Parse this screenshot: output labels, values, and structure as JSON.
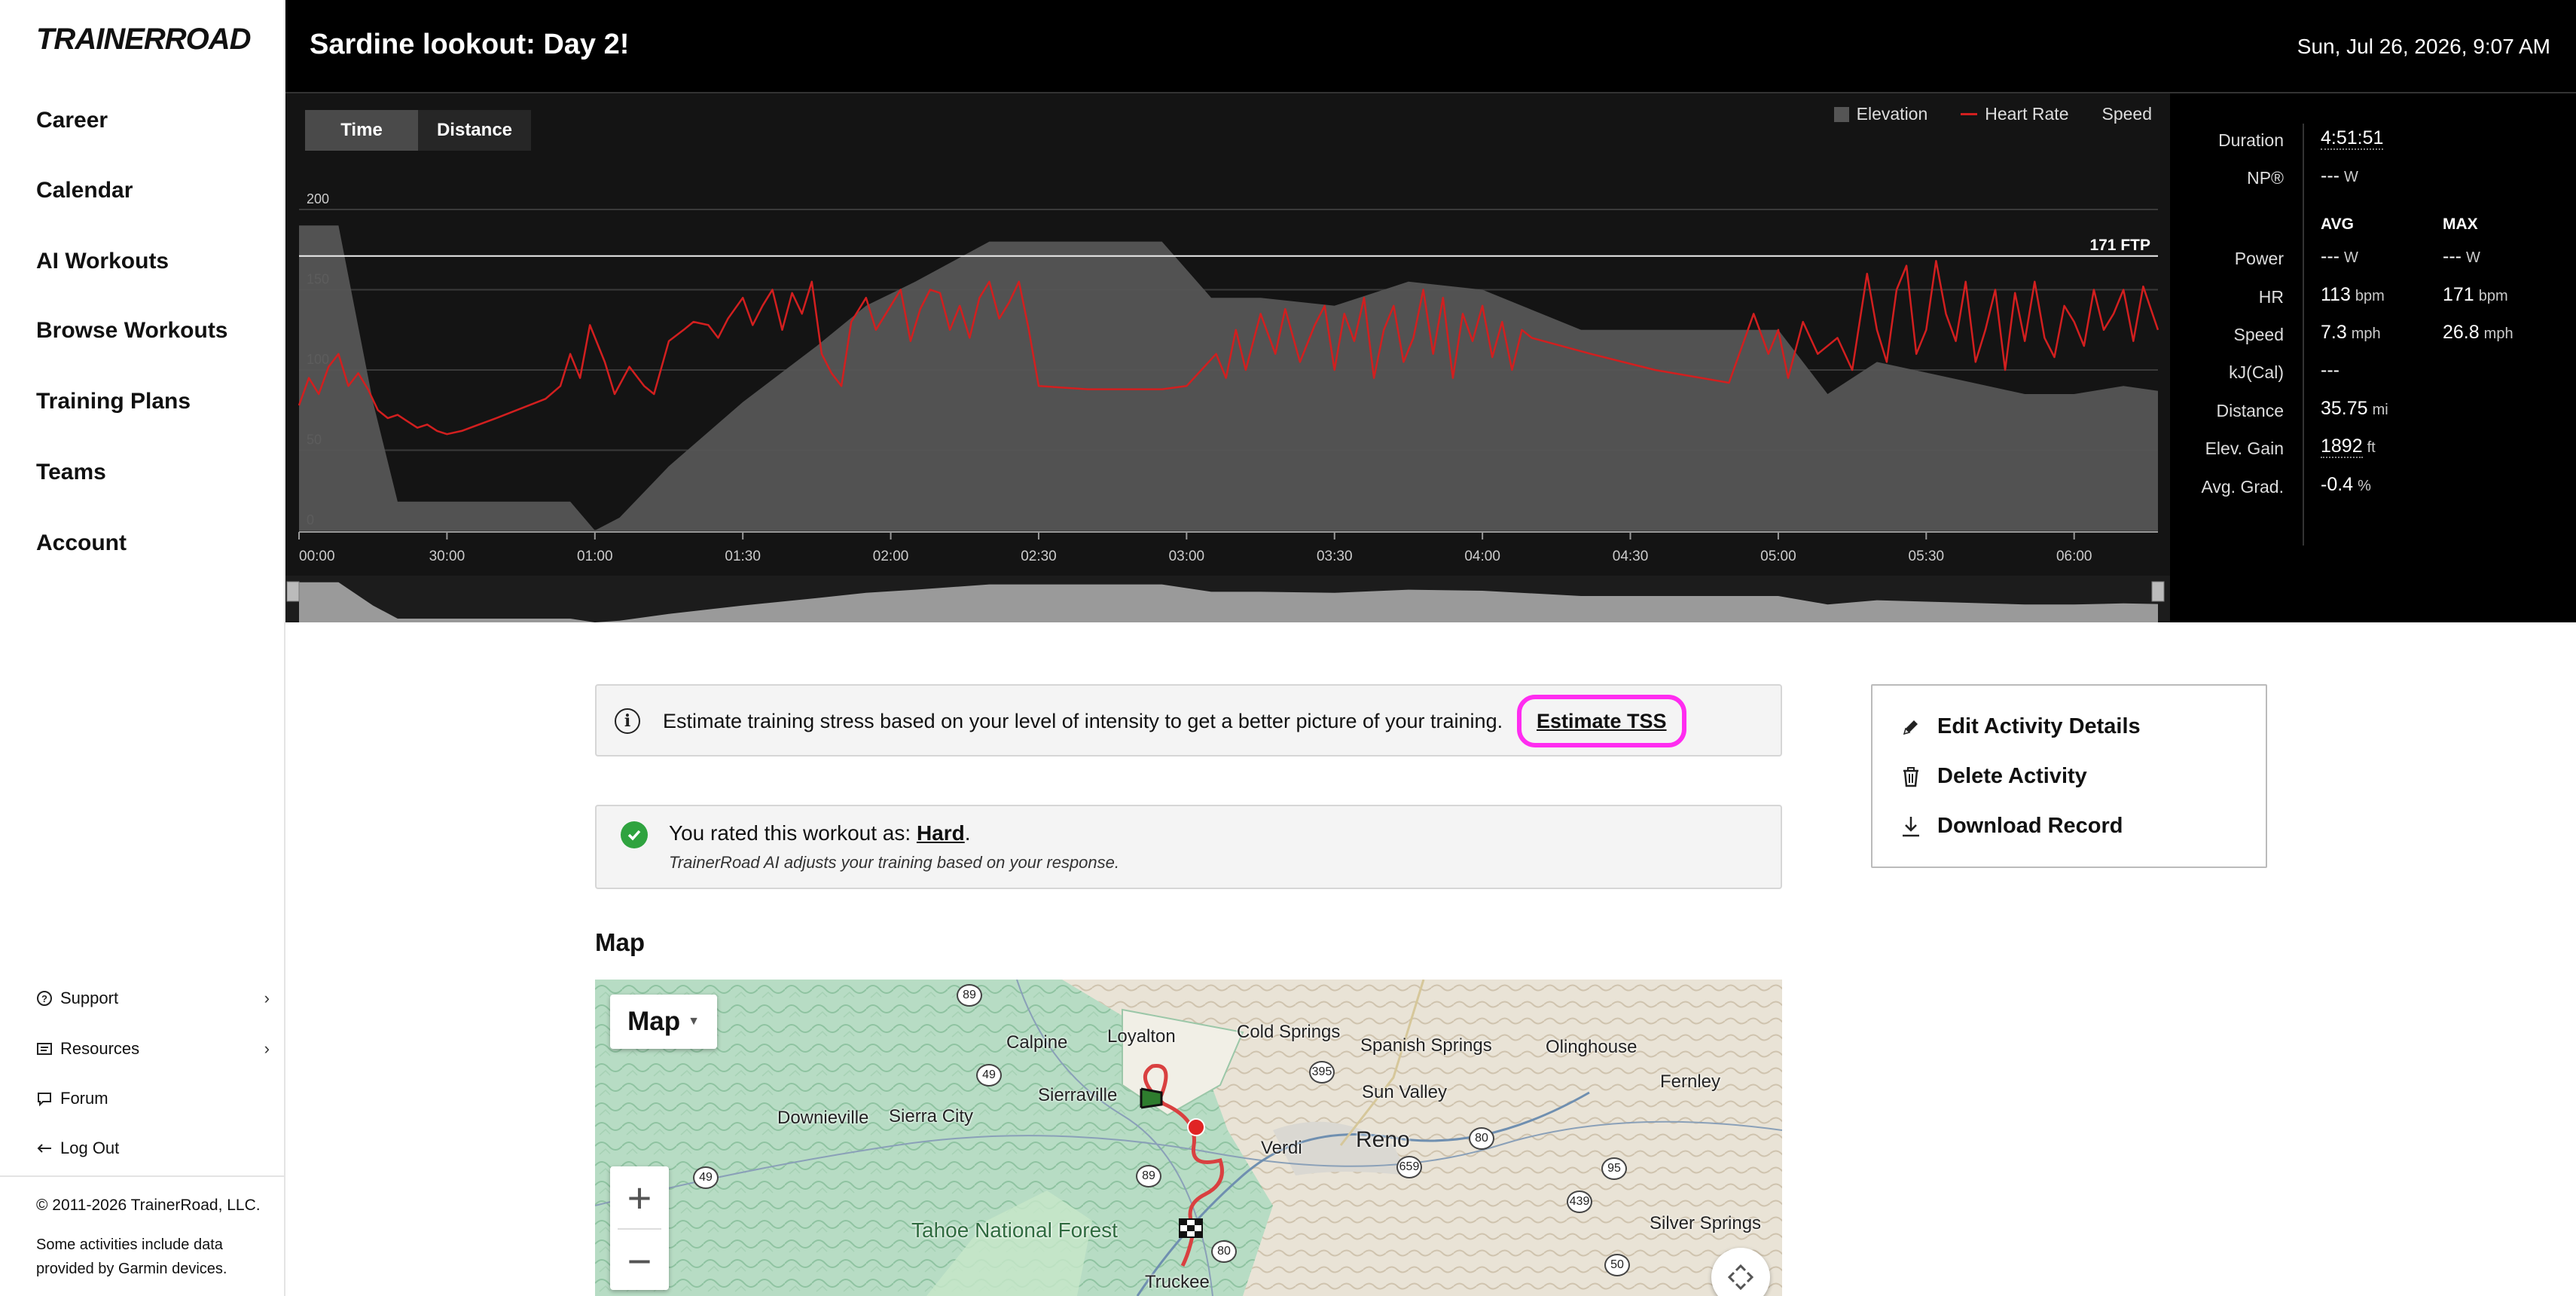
{
  "sidebar": {
    "logo": "TRAINERROAD",
    "nav": [
      "Career",
      "Calendar",
      "AI Workouts",
      "Browse Workouts",
      "Training Plans",
      "Teams",
      "Account"
    ],
    "utility": [
      {
        "label": "Support",
        "icon": "question-circle-icon",
        "has_chevron": true
      },
      {
        "label": "Resources",
        "icon": "book-icon",
        "has_chevron": true
      },
      {
        "label": "Forum",
        "icon": "chat-icon",
        "has_chevron": false
      },
      {
        "label": "Log Out",
        "icon": "arrow-left-icon",
        "has_chevron": false
      }
    ],
    "copyright": "© 2011-2026 TrainerRoad, LLC.",
    "garmin_note": "Some activities include data provided by Garmin devices."
  },
  "header": {
    "title": "Sardine lookout: Day 2!",
    "date": "Sun, Jul 26, 2026, 9:07 AM"
  },
  "chart": {
    "tabs": [
      {
        "label": "Time",
        "active": true
      },
      {
        "label": "Distance",
        "active": false
      }
    ],
    "legend": [
      {
        "label": "Elevation",
        "kind": "swatch",
        "color": "#555555"
      },
      {
        "label": "Heart Rate",
        "kind": "line",
        "color": "#d21f1f"
      },
      {
        "label": "Speed",
        "kind": "none",
        "color": "#888888"
      }
    ],
    "ftp_label": "171 FTP"
  },
  "chart_data": {
    "type": "line",
    "xlabel": "",
    "ylabel": "",
    "y_ticks": [
      "0",
      "50",
      "100",
      "150",
      "200"
    ],
    "ylim": [
      0,
      200
    ],
    "x_ticks": [
      "00:00",
      "30:00",
      "01:00",
      "01:30",
      "02:00",
      "02:30",
      "03:00",
      "03:30",
      "04:00",
      "04:30",
      "05:00",
      "05:30",
      "06:00"
    ],
    "x_tick_minutes": [
      0,
      30,
      60,
      90,
      120,
      150,
      180,
      210,
      240,
      270,
      300,
      330,
      360
    ],
    "xlim_minutes": [
      0,
      377
    ],
    "ftp_line": {
      "label": "171 FTP",
      "value": 171
    },
    "series": [
      {
        "name": "Elevation",
        "kind": "area",
        "color": "#555555",
        "x_minutes": [
          0,
          8,
          15,
          20,
          55,
          60,
          65,
          75,
          90,
          105,
          115,
          125,
          140,
          150,
          175,
          185,
          195,
          210,
          225,
          240,
          260,
          280,
          300,
          310,
          320,
          335,
          350,
          360,
          370,
          377
        ],
        "values": [
          190,
          190,
          80,
          18,
          18,
          0,
          8,
          40,
          80,
          115,
          140,
          155,
          180,
          180,
          180,
          145,
          145,
          140,
          155,
          150,
          125,
          125,
          125,
          85,
          105,
          95,
          85,
          85,
          90,
          87
        ]
      },
      {
        "name": "Heart Rate",
        "kind": "line",
        "color": "#d21f1f",
        "x_minutes": [
          0,
          2,
          4,
          6,
          8,
          10,
          12,
          14,
          16,
          18,
          20,
          22,
          24,
          26,
          28,
          30,
          33,
          40,
          50,
          53,
          55,
          57,
          59,
          62,
          64,
          67,
          70,
          72,
          75,
          78,
          80,
          83,
          85,
          87,
          90,
          92,
          94,
          96,
          98,
          100,
          102,
          104,
          106,
          108,
          110,
          112,
          115,
          117,
          120,
          122,
          124,
          126,
          128,
          130,
          132,
          134,
          136,
          138,
          140,
          142,
          144,
          146,
          148,
          150,
          160,
          175,
          180,
          183,
          186,
          188,
          190,
          192,
          195,
          198,
          200,
          203,
          206,
          208,
          210,
          212,
          214,
          216,
          218,
          220,
          222,
          224,
          226,
          228,
          230,
          232,
          234,
          236,
          238,
          240,
          242,
          244,
          246,
          248,
          250,
          262,
          275,
          290,
          295,
          298,
          300,
          302,
          305,
          308,
          312,
          315,
          318,
          320,
          322,
          324,
          326,
          328,
          330,
          332,
          334,
          336,
          338,
          340,
          342,
          344,
          346,
          348,
          350,
          352,
          354,
          356,
          358,
          360,
          362,
          364,
          366,
          368,
          370,
          372,
          374,
          377
        ],
        "values": [
          78,
          95,
          85,
          102,
          110,
          90,
          98,
          88,
          75,
          70,
          72,
          68,
          64,
          66,
          62,
          60,
          62,
          70,
          82,
          90,
          110,
          95,
          128,
          105,
          85,
          102,
          90,
          85,
          118,
          125,
          130,
          128,
          120,
          132,
          145,
          128,
          140,
          150,
          125,
          148,
          135,
          155,
          110,
          98,
          90,
          130,
          145,
          125,
          140,
          150,
          118,
          138,
          150,
          148,
          125,
          140,
          120,
          145,
          155,
          132,
          142,
          155,
          125,
          90,
          88,
          88,
          90,
          100,
          110,
          95,
          125,
          100,
          135,
          110,
          138,
          105,
          128,
          140,
          100,
          135,
          118,
          145,
          95,
          125,
          140,
          105,
          120,
          150,
          110,
          145,
          95,
          135,
          118,
          140,
          108,
          130,
          100,
          125,
          120,
          110,
          100,
          92,
          135,
          110,
          125,
          95,
          130,
          110,
          120,
          100,
          160,
          125,
          105,
          150,
          165,
          110,
          125,
          168,
          135,
          118,
          155,
          105,
          125,
          150,
          100,
          148,
          118,
          155,
          120,
          108,
          140,
          130,
          115,
          150,
          125,
          135,
          150,
          118,
          152,
          125
        ]
      }
    ],
    "legend_position": "top-right",
    "grid": true
  },
  "stats": {
    "rows": [
      {
        "label": "Duration",
        "avg": "4:51:51",
        "avg_unit": "",
        "max": "",
        "max_unit": ""
      },
      {
        "label": "NP®",
        "avg": "---",
        "avg_unit": "W",
        "max": "",
        "max_unit": ""
      },
      {
        "label": "Power",
        "avg": "---",
        "avg_unit": "W",
        "max": "---",
        "max_unit": "W"
      },
      {
        "label": "HR",
        "avg": "113",
        "avg_unit": "bpm",
        "max": "171",
        "max_unit": "bpm"
      },
      {
        "label": "Speed",
        "avg": "7.3",
        "avg_unit": "mph",
        "max": "26.8",
        "max_unit": "mph"
      },
      {
        "label": "kJ(Cal)",
        "avg": "---",
        "avg_unit": "",
        "max": "",
        "max_unit": ""
      },
      {
        "label": "Distance",
        "avg": "35.75",
        "avg_unit": "mi",
        "max": "",
        "max_unit": ""
      },
      {
        "label": "Elev. Gain",
        "avg": "1892",
        "avg_unit": "ft",
        "max": "",
        "max_unit": ""
      },
      {
        "label": "Avg. Grad.",
        "avg": "-0.4",
        "avg_unit": "%",
        "max": "",
        "max_unit": ""
      }
    ],
    "avg_heading": "AVG",
    "max_heading": "MAX"
  },
  "tss_banner": {
    "text": "Estimate training stress based on your level of intensity to get a better picture of your training.",
    "link": "Estimate TSS",
    "highlight_color": "#ff2cf0"
  },
  "rating": {
    "prefix": "You rated this workout as: ",
    "value": "Hard",
    "suffix": ".",
    "note": "TrainerRoad AI adjusts your training based on your response."
  },
  "map": {
    "heading": "Map",
    "type_button": "Map",
    "places": [
      {
        "label": "Loyalton",
        "cls": ""
      },
      {
        "label": "Cold Springs",
        "cls": ""
      },
      {
        "label": "Calpine",
        "cls": ""
      },
      {
        "label": "Spanish Springs",
        "cls": ""
      },
      {
        "label": "Olinghouse",
        "cls": ""
      },
      {
        "label": "Sierraville",
        "cls": ""
      },
      {
        "label": "Sun Valley",
        "cls": ""
      },
      {
        "label": "Fernley",
        "cls": ""
      },
      {
        "label": "Downieville",
        "cls": ""
      },
      {
        "label": "Sierra City",
        "cls": ""
      },
      {
        "label": "Reno",
        "cls": "big"
      },
      {
        "label": "Verdi",
        "cls": ""
      },
      {
        "label": "Tahoe National Forest",
        "cls": "forest"
      },
      {
        "label": "Silver Springs",
        "cls": ""
      },
      {
        "label": "Truckee",
        "cls": ""
      }
    ],
    "shields": [
      "89",
      "49",
      "395",
      "80",
      "659",
      "49",
      "89",
      "80",
      "439",
      "95",
      "50"
    ]
  },
  "actions": [
    {
      "label": "Edit Activity Details",
      "icon": "pencil-icon"
    },
    {
      "label": "Delete Activity",
      "icon": "trash-icon"
    },
    {
      "label": "Download Record",
      "icon": "download-icon"
    }
  ]
}
